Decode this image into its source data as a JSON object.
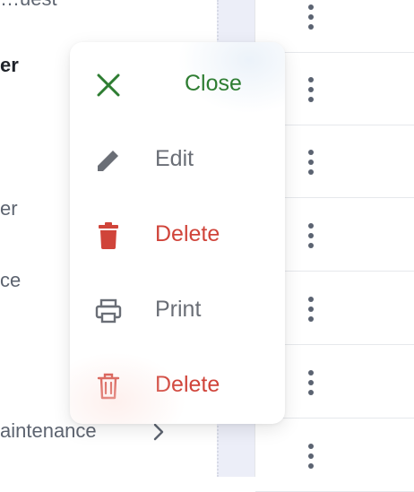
{
  "left_list": {
    "items": [
      {
        "label": "…uest"
      },
      {
        "label": "er"
      },
      {
        "label": "er"
      },
      {
        "label": "ce"
      },
      {
        "label": "aintenance"
      }
    ]
  },
  "menu": {
    "items": [
      {
        "label": "Close",
        "icon": "close-icon",
        "color": "#2e7d32"
      },
      {
        "label": "Edit",
        "icon": "pencil-icon",
        "color": "#6a6e76"
      },
      {
        "label": "Delete",
        "icon": "trash-icon",
        "color": "#d0443a"
      },
      {
        "label": "Print",
        "icon": "printer-icon",
        "color": "#6a6e76"
      },
      {
        "label": "Delete",
        "icon": "trash-outline-icon",
        "color": "#d0443a"
      }
    ]
  },
  "right_list": {
    "row_count": 7,
    "action_icon": "more-vertical-icon"
  }
}
